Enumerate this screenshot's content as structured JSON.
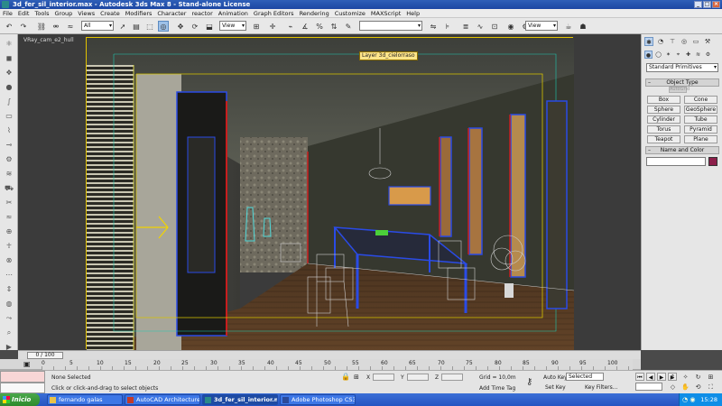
{
  "window": {
    "title": "3d_fer_sil_interior.max - Autodesk 3ds Max 8 - Stand-alone License",
    "controls": [
      "_",
      "□",
      "×"
    ]
  },
  "menu": [
    "File",
    "Edit",
    "Tools",
    "Group",
    "Views",
    "Create",
    "Modifiers",
    "Character",
    "reactor",
    "Animation",
    "Graph Editors",
    "Rendering",
    "Customize",
    "MAXScript",
    "Help"
  ],
  "toolbar": {
    "selection_filter": "All",
    "ref_coord": "View",
    "named_selection": "",
    "render_type": "View"
  },
  "viewport": {
    "label": "VRay_cam_e2_hull",
    "layer_tooltip": "Layer 3d_cielorraso"
  },
  "command_panel": {
    "category": "Standard Primitives",
    "object_type_header": "Object Type",
    "autogrid": "AutoGrid",
    "object_buttons": [
      "Box",
      "Cone",
      "Sphere",
      "GeoSphere",
      "Cylinder",
      "Tube",
      "Torus",
      "Pyramid",
      "Teapot",
      "Plane"
    ],
    "name_color_header": "Name and Color",
    "swatch_color": "#8c1f4a"
  },
  "time": {
    "slider_label": "0 / 100",
    "ticks": [
      "0",
      "5",
      "10",
      "15",
      "20",
      "25",
      "30",
      "35",
      "40",
      "45",
      "50",
      "55",
      "60",
      "65",
      "70",
      "75",
      "80",
      "85",
      "90",
      "95",
      "100"
    ]
  },
  "status": {
    "selection": "None Selected",
    "prompt": "Click or click-and-drag to select objects",
    "x_label": "X",
    "y_label": "Y",
    "z_label": "Z",
    "grid": "Grid = 10,0m",
    "add_time_tag": "Add Time Tag",
    "auto_key": "Auto Key",
    "auto_key_value": "Selected",
    "set_key": "Set Key",
    "key_filters": "Key Filters..."
  },
  "taskbar": {
    "start": "Inicio",
    "tasks": [
      {
        "label": "fernando galas",
        "color": "#e8c24a"
      },
      {
        "label": "AutoCAD Architecture 2...",
        "color": "#c23b2a"
      },
      {
        "label": "3d_fer_sil_interior.m...",
        "color": "#2a8a8a"
      },
      {
        "label": "Adobe Photoshop CS3 E...",
        "color": "#2a4a9a"
      }
    ],
    "clock": "15:28"
  }
}
